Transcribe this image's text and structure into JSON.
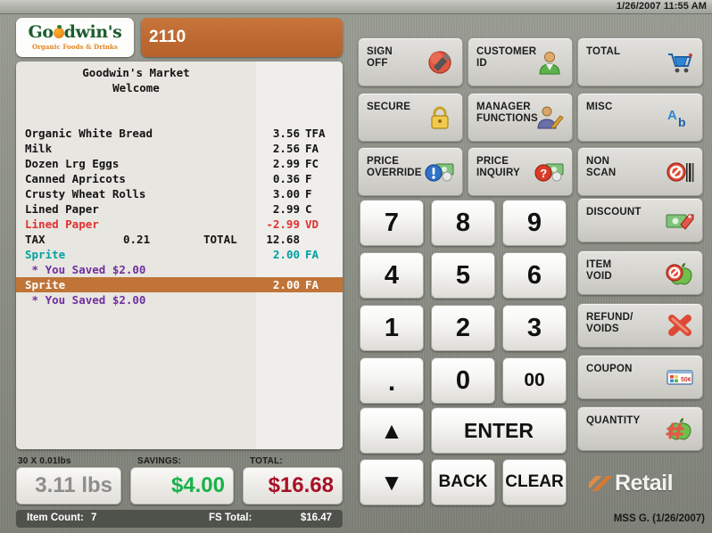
{
  "topbar": {
    "clock": "1/26/2007 11:55 AM"
  },
  "brand": {
    "name_part1": "Go",
    "name_part2": "dwin's",
    "tagline": "Organic Foods & Drinks",
    "green": "#1d5c2e",
    "orange": "#e08522"
  },
  "transaction": {
    "number": "2110",
    "bar_color": "#bd6a32"
  },
  "receipt": {
    "header_line1": "Goodwin's Market",
    "header_line2": "Welcome",
    "highlight_color": "#c07437",
    "lines": [
      {
        "desc": "Organic White Bread",
        "amount": "3.56",
        "tag": "TFA",
        "color": "c-black",
        "highlight": false
      },
      {
        "desc": "Milk",
        "amount": "2.56",
        "tag": "FA",
        "color": "c-black",
        "highlight": false
      },
      {
        "desc": "Dozen Lrg Eggs",
        "amount": "2.99",
        "tag": "FC",
        "color": "c-black",
        "highlight": false
      },
      {
        "desc": "Canned Apricots",
        "amount": "0.36",
        "tag": "F",
        "color": "c-black",
        "highlight": false
      },
      {
        "desc": "Crusty Wheat Rolls",
        "amount": "3.00",
        "tag": "F",
        "color": "c-black",
        "highlight": false
      },
      {
        "desc": "Lined Paper",
        "amount": "2.99",
        "tag": "C",
        "color": "c-black",
        "highlight": false
      },
      {
        "desc": "Lined Paper",
        "amount": "-2.99",
        "tag": "VD",
        "color": "c-red",
        "highlight": false
      },
      {
        "desc": "TAX",
        "mid": "0.21",
        "mid2": "TOTAL",
        "amount": "12.68",
        "tag": "",
        "color": "c-black",
        "highlight": false
      },
      {
        "desc": "Sprite",
        "amount": "2.00",
        "tag": "FA",
        "color": "c-teal",
        "highlight": false
      },
      {
        "desc": " * You Saved $2.00",
        "amount": "",
        "tag": "",
        "color": "c-purple",
        "highlight": false
      },
      {
        "desc": "Sprite",
        "amount": "2.00",
        "tag": "FA",
        "color": "c-black",
        "highlight": true
      },
      {
        "desc": " * You Saved $2.00",
        "amount": "",
        "tag": "",
        "color": "c-purple",
        "highlight": false
      }
    ]
  },
  "totals": {
    "weight_label": "30 X 0.01lbs",
    "weight_value": "3.11 lbs",
    "savings_label": "SAVINGS:",
    "savings_value": "$4.00",
    "savings_color": "#18b24a",
    "total_label": "TOTAL:",
    "total_value": "$16.68",
    "total_color": "#a81128"
  },
  "statusbar": {
    "item_count_label": "Item Count:",
    "item_count_value": "7",
    "fs_total_label": "FS Total:",
    "fs_total_value": "$16.47",
    "operator": "MSS G. (1/26/2007)"
  },
  "function_buttons": [
    {
      "label": "SIGN\nOFF",
      "icon": "sign-off-plug-icon"
    },
    {
      "label": "CUSTOMER\nID",
      "icon": "customer-person-icon"
    },
    {
      "label": "TOTAL",
      "icon": "shopping-cart-icon"
    },
    {
      "label": "SECURE",
      "icon": "padlock-icon"
    },
    {
      "label": "MANAGER\nFUNCTIONS",
      "icon": "manager-person-pencil-icon"
    },
    {
      "label": "MISC",
      "icon": "ab-letters-icon"
    },
    {
      "label": "PRICE\nOVERRIDE",
      "icon": "blue-exclamation-money-icon"
    },
    {
      "label": "PRICE\nINQUIRY",
      "icon": "red-question-money-icon"
    },
    {
      "label": "NON\nSCAN",
      "icon": "no-barcode-icon"
    },
    {
      "label": "DISCOUNT",
      "icon": "money-tag-icon"
    },
    {
      "label": "ITEM\nVOID",
      "icon": "no-apple-icon"
    },
    {
      "label": "REFUND/\nVOIDS",
      "icon": "red-x-icon"
    },
    {
      "label": "COUPON",
      "icon": "coupon-ticket-icon"
    },
    {
      "label": "QUANTITY",
      "icon": "hash-apple-icon"
    }
  ],
  "keypad": {
    "keys": [
      "7",
      "8",
      "9",
      "4",
      "5",
      "6",
      "1",
      "2",
      "3",
      ".",
      "0",
      "00"
    ],
    "enter": "ENTER",
    "back": "BACK",
    "clear": "CLEAR",
    "up_arrow": "▲",
    "down_arrow": "▼"
  },
  "retail_logo": {
    "text": "Retail"
  }
}
